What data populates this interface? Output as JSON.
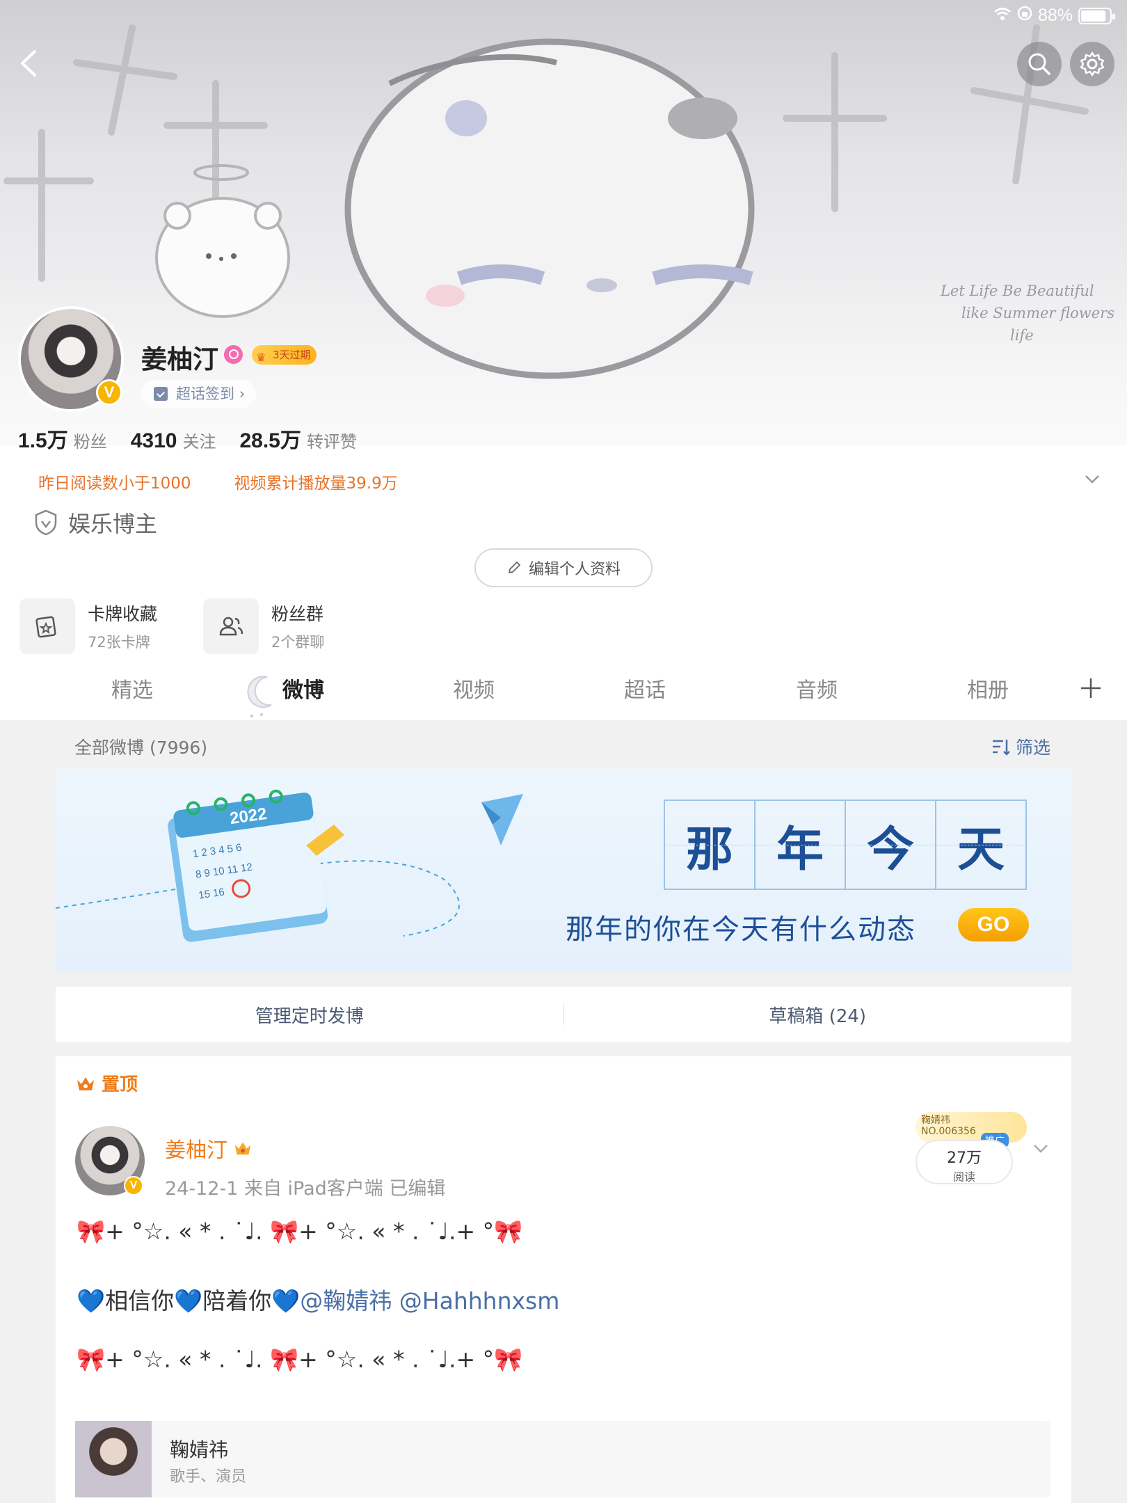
{
  "status_bar": {
    "battery": "88%",
    "battery_level": 0.88
  },
  "banner": {
    "script_lines": [
      "Let Life Be Beautiful",
      "like Summer flowers",
      "life"
    ]
  },
  "profile": {
    "name": "姜柚汀",
    "vip_badge": "3天过期",
    "checkin_label": "超话签到",
    "stats": [
      {
        "num": "1.5万",
        "label": "粉丝"
      },
      {
        "num": "4310",
        "label": "关注"
      },
      {
        "num": "28.5万",
        "label": "转评赞"
      }
    ],
    "alerts": [
      "昨日阅读数小于1000",
      "视频累计播放量39.9万"
    ],
    "verify_label": "娱乐博主",
    "edit_button": "编辑个人资料"
  },
  "tools": [
    {
      "title": "卡牌收藏",
      "sub": "72张卡牌",
      "icon": "card-icon"
    },
    {
      "title": "粉丝群",
      "sub": "2个群聊",
      "icon": "group-icon"
    }
  ],
  "tabs": [
    "精选",
    "微博",
    "视频",
    "超话",
    "音频",
    "相册"
  ],
  "active_tab": "微博",
  "feed": {
    "header": "全部微博 (7996)",
    "filter": "筛选",
    "promo": {
      "chars": [
        "那",
        "年",
        "今",
        "天"
      ],
      "sub": "那年的你在今天有什么动态",
      "go": "GO",
      "calendar_year": "2022"
    },
    "manage": [
      "管理定时发博",
      "草稿箱 (24)"
    ]
  },
  "post": {
    "pin_label": "置顶",
    "author": "姜柚汀",
    "meta": "24-12-1  来自 iPad客户端  已编辑",
    "read_tag_top": "鞠婧祎",
    "read_tag_no": "NO.006356",
    "push_label": "推广",
    "read_count": "27万",
    "read_label": "阅读",
    "line1": "+ °☆. « * . ˙♩. ",
    "line1b": "+ °☆. « * . ˙♩.+ °",
    "line2_a": "相信你",
    "line2_b": "陪着你",
    "mention1": "@鞠婧祎",
    "mention2": "@Hahhhnxsm",
    "bow": "🎀",
    "heart": "💙",
    "tag_title": "鞠婧祎",
    "tag_sub": "歌手、演员"
  },
  "colors": {
    "accent_orange": "#f07c18",
    "link_blue": "#4a6fa5",
    "vip_gold": "#f7b500"
  }
}
